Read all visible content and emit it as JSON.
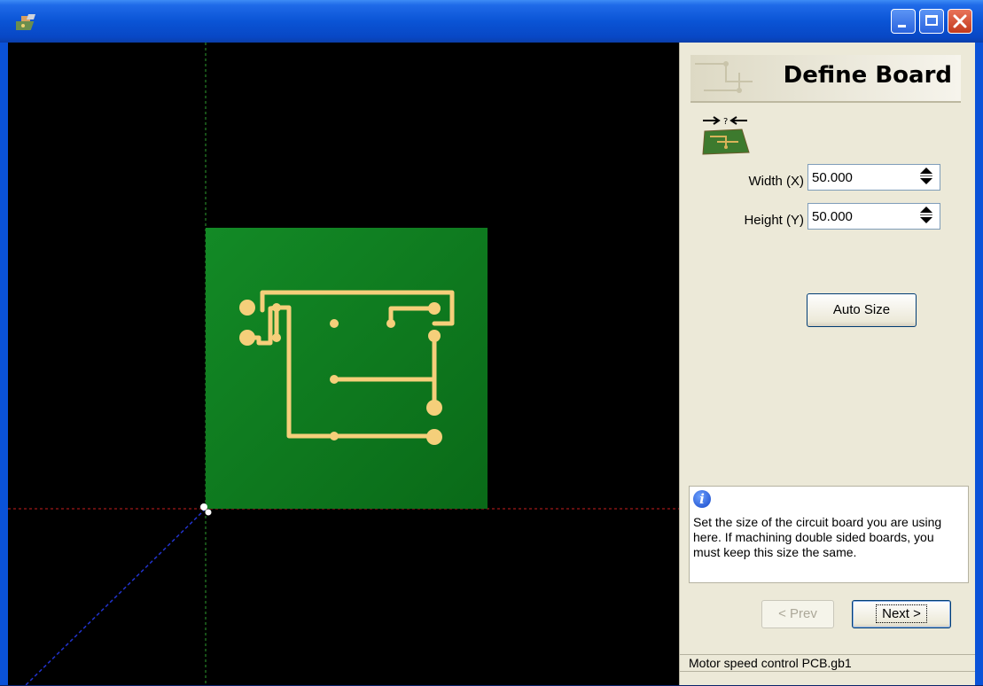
{
  "window": {
    "title": ""
  },
  "panel": {
    "heading": "Define Board",
    "width_label": "Width (X)",
    "width_value": "50.000",
    "height_label": "Height (Y)",
    "height_value": "50.000",
    "auto_size_label": "Auto Size",
    "info_text": "Set the size of the circuit board you are using here. If machining double sided boards, you must keep this size the same.",
    "prev_label": "< Prev",
    "next_label": "Next >",
    "status_text": "Motor speed control PCB.gb1"
  },
  "colors": {
    "board": "#0d7a1f",
    "trace": "#f5cf7a",
    "canvas": "#000000",
    "x_axis": "#c81e1e",
    "y_axis": "#2e9e2e",
    "z_axis": "#2233cc"
  },
  "icons": {
    "app": "app-icon",
    "minimize": "minimize-icon",
    "maximize": "maximize-icon",
    "close": "close-icon",
    "board": "board-size-icon",
    "info": "info-icon",
    "spin_up": "spin-up-icon",
    "spin_down": "spin-down-icon"
  }
}
